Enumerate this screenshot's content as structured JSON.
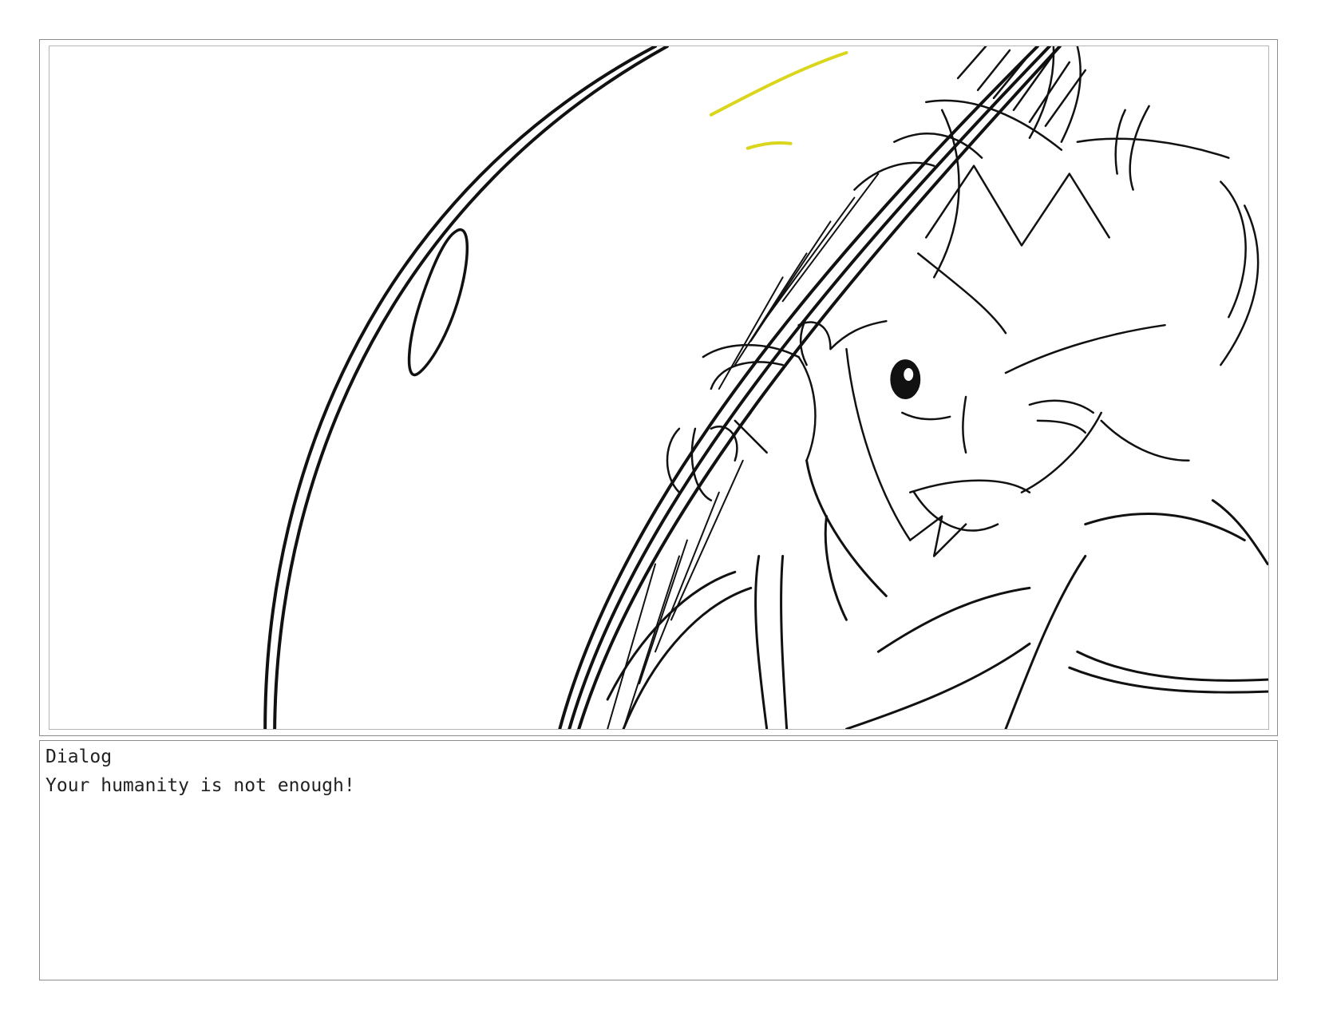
{
  "panel": {
    "image": "storyboard-sketch"
  },
  "dialog": {
    "label": "Dialog",
    "text": "Your humanity is not enough!"
  },
  "colors": {
    "line": "#111111",
    "accent": "#d9d61c",
    "frame": "#8c8c8c"
  }
}
